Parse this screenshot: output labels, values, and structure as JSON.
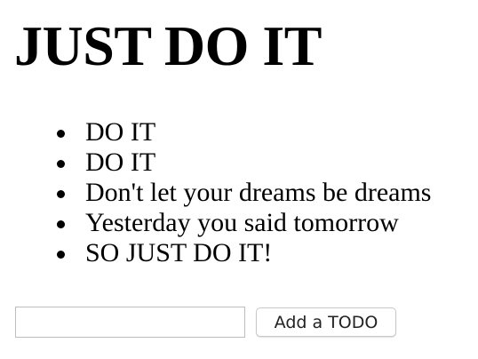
{
  "page_title": "JUST DO IT",
  "todos": [
    {
      "text": "DO IT"
    },
    {
      "text": "DO IT"
    },
    {
      "text": "Don't let your dreams be dreams"
    },
    {
      "text": "Yesterday you said tomorrow"
    },
    {
      "text": "SO JUST DO IT!"
    }
  ],
  "form": {
    "input_value": "",
    "add_label": "Add a TODO"
  }
}
